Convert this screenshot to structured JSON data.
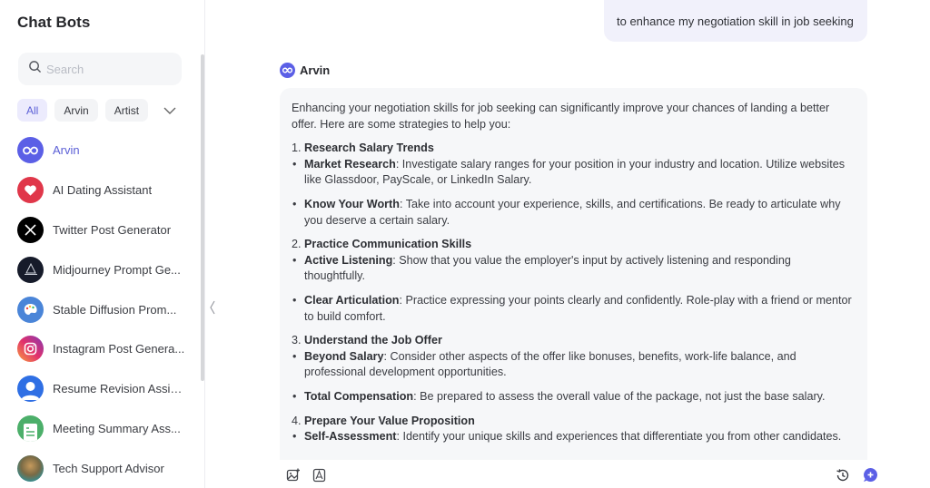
{
  "sidebar": {
    "title": "Chat Bots",
    "search_placeholder": "Search",
    "filters": [
      {
        "label": "All",
        "active": true
      },
      {
        "label": "Arvin",
        "active": false
      },
      {
        "label": "Artist",
        "active": false
      }
    ],
    "bots": [
      {
        "name": "Arvin",
        "icon": "infinity-icon",
        "color": "#5b5fe6",
        "active": true
      },
      {
        "name": "AI Dating Assistant",
        "icon": "heart-icon",
        "color": "#e0374a"
      },
      {
        "name": "Twitter Post Generator",
        "icon": "x-logo-icon",
        "color": "#000000"
      },
      {
        "name": "Midjourney Prompt Ge...",
        "icon": "sailboat-icon",
        "color": "#161b2a"
      },
      {
        "name": "Stable Diffusion Prom...",
        "icon": "palette-icon",
        "color": "#4a85d8"
      },
      {
        "name": "Instagram Post Genera...",
        "icon": "instagram-icon",
        "color": "#d6317a"
      },
      {
        "name": "Resume Revision Assis...",
        "icon": "person-icon",
        "color": "#2f6fe4"
      },
      {
        "name": "Meeting Summary Ass...",
        "icon": "document-icon",
        "color": "#4caf6a"
      },
      {
        "name": "Tech Support Advisor",
        "icon": "character-avatar-icon",
        "color": "#3b8a8a"
      }
    ]
  },
  "chat": {
    "user_message": "to enhance my negotiation skill in job seeking",
    "bot_name": "Arvin",
    "answer": {
      "intro": "Enhancing your negotiation skills for job seeking can significantly improve your chances of landing a better offer. Here are some strategies to help you:",
      "sections": [
        {
          "number": "1.",
          "title": "Research Salary Trends",
          "bullets": [
            {
              "term": "Market Research",
              "text": ": Investigate salary ranges for your position in your industry and location. Utilize websites like Glassdoor, PayScale, or LinkedIn Salary."
            },
            {
              "term": "Know Your Worth",
              "text": ": Take into account your experience, skills, and certifications. Be ready to articulate why you deserve a certain salary."
            }
          ]
        },
        {
          "number": "2.",
          "title": "Practice Communication Skills",
          "bullets": [
            {
              "term": "Active Listening",
              "text": ": Show that you value the employer's input by actively listening and responding thoughtfully."
            },
            {
              "term": "Clear Articulation",
              "text": ": Practice expressing your points clearly and confidently. Role-play with a friend or mentor to build comfort."
            }
          ]
        },
        {
          "number": "3.",
          "title": "Understand the Job Offer",
          "bullets": [
            {
              "term": "Beyond Salary",
              "text": ": Consider other aspects of the offer like bonuses, benefits, work-life balance, and professional development opportunities."
            },
            {
              "term": "Total Compensation",
              "text": ": Be prepared to assess the overall value of the package, not just the base salary."
            }
          ]
        },
        {
          "number": "4.",
          "title": "Prepare Your Value Proposition",
          "bullets": [
            {
              "term": "Self-Assessment",
              "text": ": Identify your unique skills and experiences that differentiate you from other candidates."
            }
          ]
        }
      ]
    },
    "toolbar": {
      "left": [
        "image-upload-icon",
        "pdf-icon"
      ],
      "right": [
        "history-icon",
        "new-chat-icon"
      ]
    }
  },
  "colors": {
    "accent": "#5b5fe6",
    "user_bubble": "#f1f1fb",
    "answer_bg": "#f6f7f9"
  }
}
